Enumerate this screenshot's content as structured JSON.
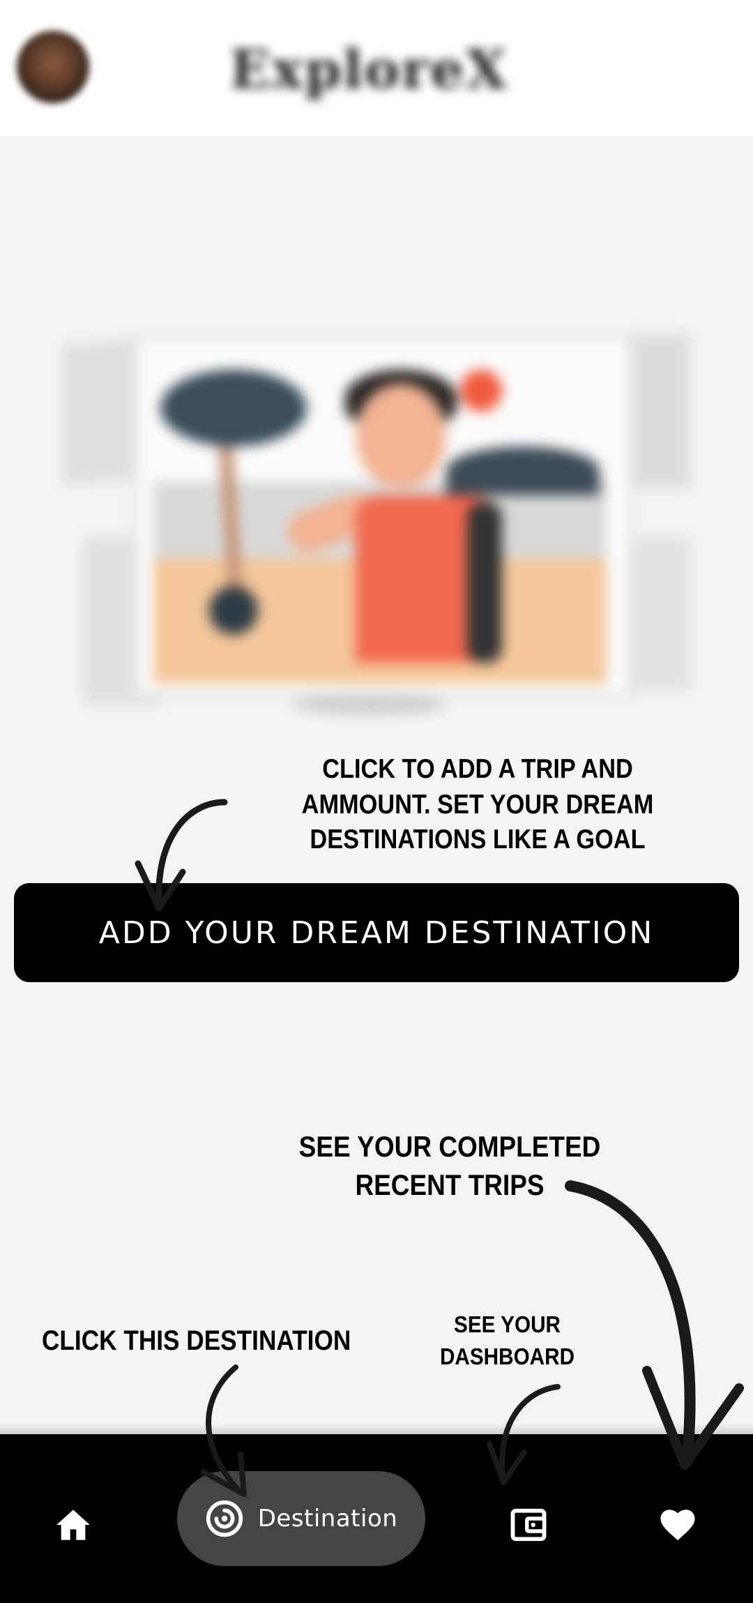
{
  "header": {
    "app_title": "ExploreX",
    "avatar_icon": "user-avatar"
  },
  "hero": {
    "illustration": "traveler-beach-illustration"
  },
  "hints": {
    "add_trip": "CLICK TO ADD A TRIP AND AMMOUNT. SET YOUR DREAM DESTINATIONS LIKE A GOAL",
    "completed_trips": "SEE YOUR COMPLETED RECENT TRIPS",
    "dashboard": "SEE YOUR DASHBOARD",
    "destination": "CLICK THIS DESTINATION"
  },
  "main": {
    "add_button_label": "ADD YOUR DREAM DESTINATION"
  },
  "bottom_nav": {
    "items": [
      {
        "id": "home",
        "icon": "home-icon"
      },
      {
        "id": "destination",
        "icon": "target-icon",
        "label": "Destination",
        "active": true
      },
      {
        "id": "dashboard",
        "icon": "wallet-icon"
      },
      {
        "id": "favorites",
        "icon": "heart-icon"
      }
    ]
  },
  "colors": {
    "nav_background": "#000000",
    "active_pill": "#444444",
    "button_background": "#000000",
    "button_text": "#ffffff",
    "page_background": "#f4f4f4"
  }
}
